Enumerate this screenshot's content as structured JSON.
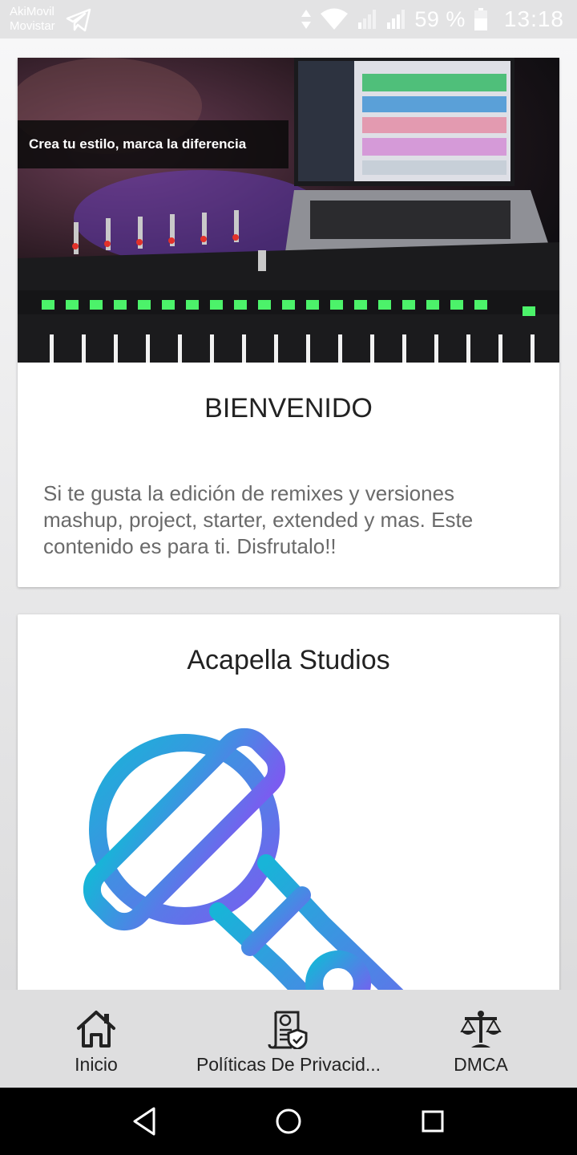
{
  "status_bar": {
    "carrier_line1": "AkiMovil",
    "carrier_line2": "Movistar",
    "battery_percent": "59 %",
    "time": "13:18"
  },
  "welcome_card": {
    "image_caption": "Crea tu estilo, marca la diferencia",
    "title": "BIENVENIDO",
    "text": "Si te gusta la edición de remixes y versiones mashup, project, starter, extended y mas. Este contenido es para ti. Disfrutalo!!"
  },
  "studio_card": {
    "title": "Acapella Studios",
    "icon": "microphone-icon"
  },
  "bottom_nav": {
    "items": [
      {
        "label": "Inicio",
        "icon": "home-icon"
      },
      {
        "label": "Políticas De Privacid...",
        "icon": "privacy-policy-icon"
      },
      {
        "label": "DMCA",
        "icon": "scales-icon"
      }
    ]
  },
  "colors": {
    "mic_gradient_start": "#18b4d8",
    "mic_gradient_end": "#7a5cf0"
  }
}
